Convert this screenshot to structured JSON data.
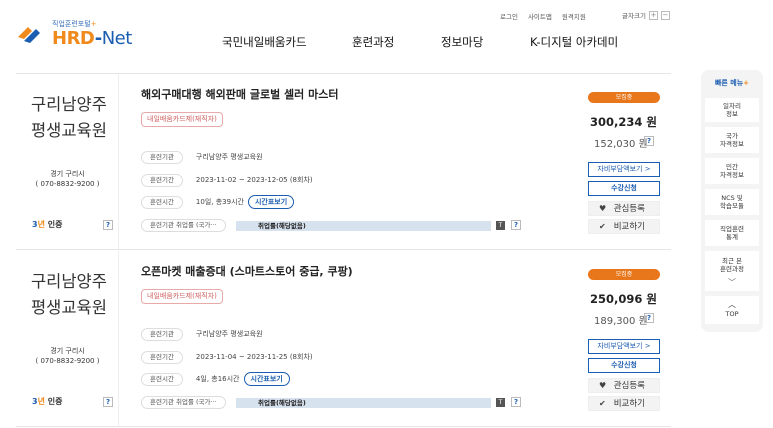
{
  "header": {
    "logo_sub": "직업훈련포털",
    "logo_hrd": "HRD",
    "logo_dash": "-",
    "logo_net": "Net",
    "util": [
      "로그인",
      "사이트맵",
      "원격지원"
    ],
    "font_label": "글자크기",
    "font_plus": "+",
    "font_minus": "−",
    "nav": [
      "국민내일배움카드",
      "훈련과정",
      "정보마당",
      "K-디지털 아카데미"
    ]
  },
  "courses": [
    {
      "institution": "구리남양주 평생교육원",
      "region": "경기 구리시",
      "phone": "( 070-8832-9200 )",
      "cert_num": "3",
      "cert_yr": "년",
      "cert_label": "인증",
      "title": "해외구매대행 해외판매 글로벌 셀러 마스터",
      "tag": "내일배움카드제(재직자)",
      "inst_label": "훈련기관",
      "inst_value": "구리남양주 평생교육원",
      "period_label": "훈련기간",
      "period_value": "2023-11-02 ~ 2023-12-05 (8회차)",
      "time_label": "훈련시간",
      "time_value": "10일, 총39시간",
      "timetable_btn": "시간표보기",
      "emp_label": "훈련기관 취업률 (국가···",
      "emp_value": "취업률(해당없음)",
      "emp_t": "T",
      "status": "모집중",
      "price": "300,234 원",
      "self_pay": "152,030 원",
      "self_pay_btn": "자비부담액보기 >",
      "apply_btn": "수강신청",
      "interest_btn": "관심등록",
      "compare_btn": "비교하기"
    },
    {
      "institution": "구리남양주 평생교육원",
      "region": "경기 구리시",
      "phone": "( 070-8832-9200 )",
      "cert_num": "3",
      "cert_yr": "년",
      "cert_label": "인증",
      "title": "오픈마켓 매출증대 (스마트스토어 중급, 쿠팡)",
      "tag": "내일배움카드제(재직자)",
      "inst_label": "훈련기관",
      "inst_value": "구리남양주 평생교육원",
      "period_label": "훈련기간",
      "period_value": "2023-11-04 ~ 2023-11-25 (8회차)",
      "time_label": "훈련시간",
      "time_value": "4일, 총16시간",
      "timetable_btn": "시간표보기",
      "emp_label": "훈련기관 취업률 (국가···",
      "emp_value": "취업률(해당없음)",
      "emp_t": "T",
      "status": "모집중",
      "price": "250,096 원",
      "self_pay": "189,300 원",
      "self_pay_btn": "자비부담액보기 >",
      "apply_btn": "수강신청",
      "interest_btn": "관심등록",
      "compare_btn": "비교하기"
    }
  ],
  "help_q": "?",
  "quick_menu": {
    "title": "빠른 메뉴",
    "plus": "+",
    "items": [
      "일자리\n정보",
      "국가\n자격정보",
      "민간\n자격정보",
      "NCS 및\n학습모듈",
      "직업훈련\n통계",
      "최근 본\n훈련과정"
    ],
    "top": "TOP"
  },
  "colors": {
    "brand_blue": "#1b5db0",
    "brand_orange": "#f08a1c",
    "status_badge": "#e8761a",
    "tag_red": "#d06262"
  },
  "icons": [
    "heart-icon",
    "check-icon",
    "chevron-down-icon",
    "chevron-up-icon",
    "help-icon"
  ]
}
